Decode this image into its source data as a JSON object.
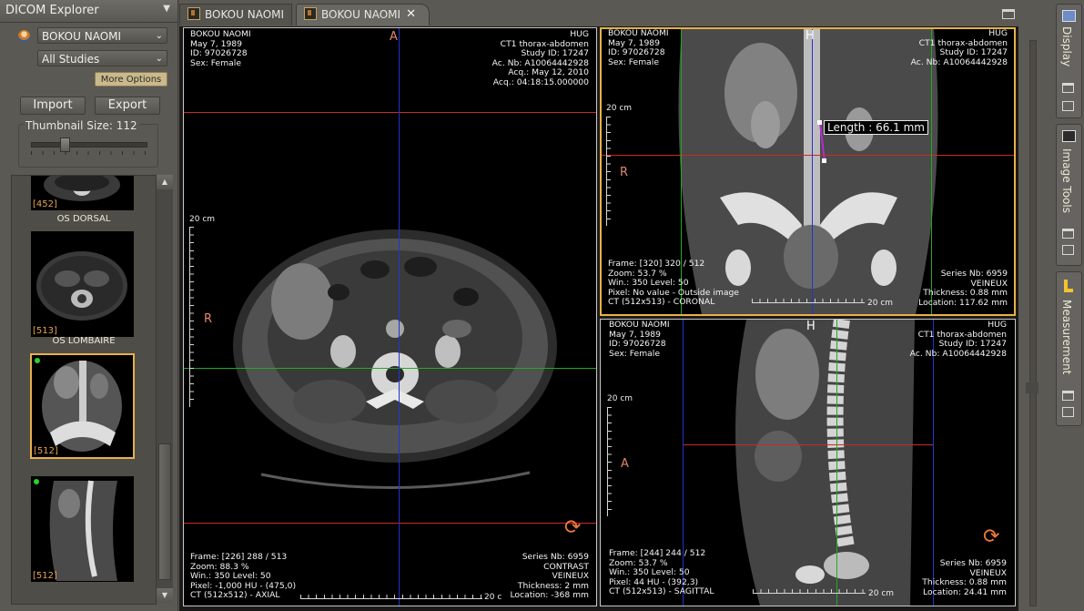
{
  "explorer": {
    "title": "DICOM Explorer",
    "menu_icon": "chevron-down-icon",
    "patient_select": "BOKOU NAOMI",
    "studies_select": "All Studies",
    "more_options": "More Options",
    "import_label": "Import",
    "export_label": "Export",
    "thumbnail_size_label": "Thumbnail Size: 112",
    "thumbnails": [
      {
        "count": "[452]",
        "caption": "OS DORSAL",
        "selected": false
      },
      {
        "count": "[513]",
        "caption": "OS LOMBAIRE",
        "selected": false
      },
      {
        "count": "[512]",
        "caption": "",
        "selected": true
      },
      {
        "count": "[512]",
        "caption": "",
        "selected": false
      }
    ]
  },
  "tabs": [
    {
      "label": "BOKOU NAOMI",
      "active": false
    },
    {
      "label": "BOKOU NAOMI",
      "active": true
    }
  ],
  "patient": {
    "name": "BOKOU NAOMI",
    "dob": "May 7, 1989",
    "id": "ID: 97026728",
    "sex": "Sex: Female",
    "institution": "HUG",
    "study": "CT1 thorax-abdomen",
    "study_id": "Study ID: 17247",
    "acc": "Ac. Nb: A10064442928",
    "acq_date": "Acq.: May 12, 2010",
    "acq_time": "Acq.: 04:18:15.000000"
  },
  "axial": {
    "orient_top": "A",
    "orient_left": "R",
    "scale": "20 cm",
    "frame": "Frame: [226] 288 / 513",
    "zoom": "Zoom: 88.3 %",
    "win": "Win.: 350 Level: 50",
    "pixel": "Pixel: -1,000 HU - (475,0)",
    "type": "CT (512x512) - AXIAL",
    "series": "Series Nb: 6959",
    "desc1": "CONTRAST",
    "desc2": "VEINEUX",
    "thickness": "Thickness: 2 mm",
    "location": "Location: -368 mm",
    "bottom_scale": "20 c"
  },
  "coronal": {
    "orient_top": "H",
    "orient_left": "R",
    "scale": "20 cm",
    "measure": "Length : 66.1 mm",
    "frame": "Frame: [320] 320 / 512",
    "zoom": "Zoom: 53.7 %",
    "win": "Win.: 350 Level: 50",
    "pixel": "Pixel: No value - Outside image",
    "type": "CT (512x513) - CORONAL",
    "series": "Series Nb: 6959",
    "desc": "VEINEUX",
    "thickness": "Thickness: 0.88 mm",
    "location": "Location: 117.62 mm",
    "bottom_scale": "20 cm"
  },
  "sagittal": {
    "orient_top": "H",
    "orient_left": "A",
    "scale": "20 cm",
    "frame": "Frame: [244] 244 / 512",
    "zoom": "Zoom: 53.7 %",
    "win": "Win.: 350 Level: 50",
    "pixel": "Pixel: 44 HU - (392,3)",
    "type": "CT (512x513) - SAGITTAL",
    "series": "Series Nb: 6959",
    "desc": "VEINEUX",
    "thickness": "Thickness: 0.88 mm",
    "location": "Location: 24.41 mm",
    "bottom_scale": "20 cm"
  },
  "dock": {
    "display": "Display",
    "image_tools": "Image Tools",
    "measurement": "Measurement"
  },
  "colors": {
    "crosshair_red": "#cc2a22",
    "crosshair_blue": "#2233cc",
    "crosshair_green": "#22aa22",
    "active_border": "#e8b04a",
    "orientation": "#e3866b",
    "thumb_count": "#e7a24c"
  }
}
